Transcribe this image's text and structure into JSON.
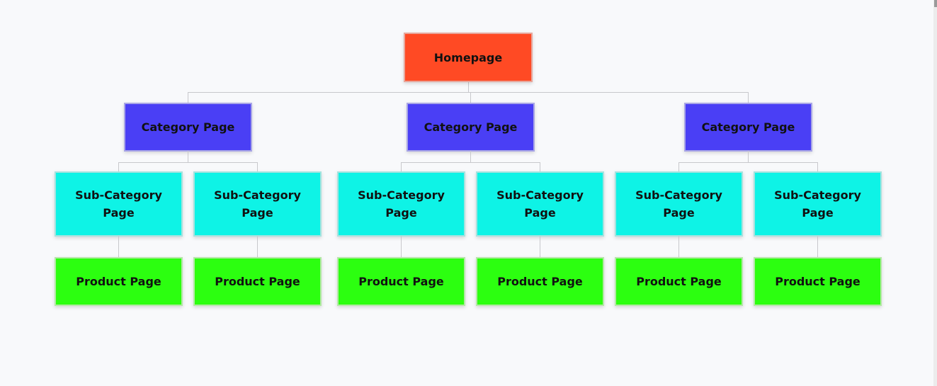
{
  "colors": {
    "homepage": "#ff4a24",
    "category": "#4a3ff5",
    "subcategory": "#0ef3e6",
    "product": "#2cff10",
    "connector": "#c8c8cc",
    "background": "#f8f9fb"
  },
  "root": {
    "label": "Homepage"
  },
  "categories": [
    {
      "label": "Category Page",
      "subcategories": [
        {
          "label": "Sub-Category Page",
          "product": "Product Page"
        },
        {
          "label": "Sub-Category Page",
          "product": "Product Page"
        }
      ]
    },
    {
      "label": "Category Page",
      "subcategories": [
        {
          "label": "Sub-Category Page",
          "product": "Product Page"
        },
        {
          "label": "Sub-Category Page",
          "product": "Product Page"
        }
      ]
    },
    {
      "label": "Category Page",
      "subcategories": [
        {
          "label": "Sub-Category Page",
          "product": "Product Page"
        },
        {
          "label": "Sub-Category Page",
          "product": "Product Page"
        }
      ]
    }
  ]
}
